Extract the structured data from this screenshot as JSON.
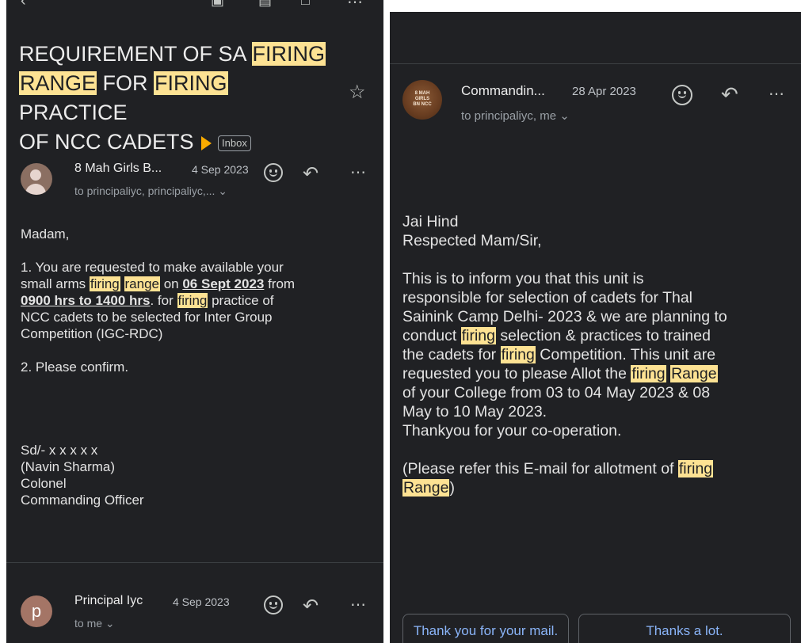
{
  "left_email": {
    "subject": {
      "line1_pre": "REQUIREMENT OF SA ",
      "line1_hl": "FIRING",
      "line2_hl1": "RANGE",
      "line2_mid": " FOR ",
      "line2_hl2": "FIRING",
      "line2_post": " PRACTICE",
      "line3": "OF NCC CADETS",
      "label": "Inbox"
    },
    "message1": {
      "sender": "8 Mah Girls B...",
      "date": "4 Sep 2023",
      "recipients": "to principaliyc, principaliyc,... ⌄",
      "greeting": "Madam,",
      "p1_l1": "1.     You are requested to make available your",
      "p1_l2_pre": "small arms ",
      "p1_l2_hl1": "firing",
      "p1_l2_hl2": "range",
      "p1_l2_mid": " on ",
      "p1_l2_bold": "06 Sept 2023",
      "p1_l2_post": " from",
      "p1_l3_bold": "0900 hrs to 1400 hrs",
      "p1_l3_mid": ". for ",
      "p1_l3_hl": "firing",
      "p1_l3_post": " practice of",
      "p1_l4": "NCC cadets  to be selected for  Inter Group",
      "p1_l5": "Competition (IGC-RDC)",
      "p2": "2.     Please confirm.",
      "sig1": "Sd/- x x x x x",
      "sig2": "(Navin Sharma)",
      "sig3": "Colonel",
      "sig4": "Commanding Officer"
    },
    "message2": {
      "avatar_letter": "p",
      "sender": "Principal Iyc",
      "date": "4 Sep 2023",
      "recipients": "to me ⌄"
    }
  },
  "right_email": {
    "sender": "Commandin...",
    "date": "28 Apr 2023",
    "recipients": "to principaliyc, me ⌄",
    "avatar_text": "8 MAH\nGIRLS\nBN NCC",
    "lines": {
      "l1": "Jai Hind",
      "l2": "Respected Mam/Sir,",
      "l3": "This is to inform you that  this unit is",
      "l4": "responsible for selection of cadets for Thal",
      "l5": "Sainink Camp Delhi- 2023 & we  are planning to",
      "l6_pre": "conduct ",
      "l6_hl": "firing",
      "l6_post": " selection & practices to trained",
      "l7_pre": "the cadets for ",
      "l7_hl": "firing",
      "l7_post": " Competition. This unit are",
      "l8_pre": "requested  you to  please Allot the ",
      "l8_hl1": "firing",
      "l8_hl2": "Range",
      "l9": "of your College from  03 to 04 May 2023 & 08",
      "l10": "May to 10 May 2023.",
      "l11": "Thankyou for your co-operation.",
      "l12_pre": "(Please refer this E-mail for allotment of ",
      "l12_hl": "firing",
      "l13_hl": "Range",
      "l13_post": ")"
    },
    "smart_replies": [
      "Thank you for your mail.",
      "Thanks a lot."
    ]
  },
  "colors": {
    "background": "#202124",
    "highlight": "#fde293",
    "link": "#8ab4f8",
    "important": "#f9ab00"
  },
  "icons": [
    "back-arrow-icon",
    "archive-icon",
    "delete-icon",
    "mail-icon",
    "more-icon",
    "star-icon",
    "smiley-icon",
    "reply-icon"
  ]
}
